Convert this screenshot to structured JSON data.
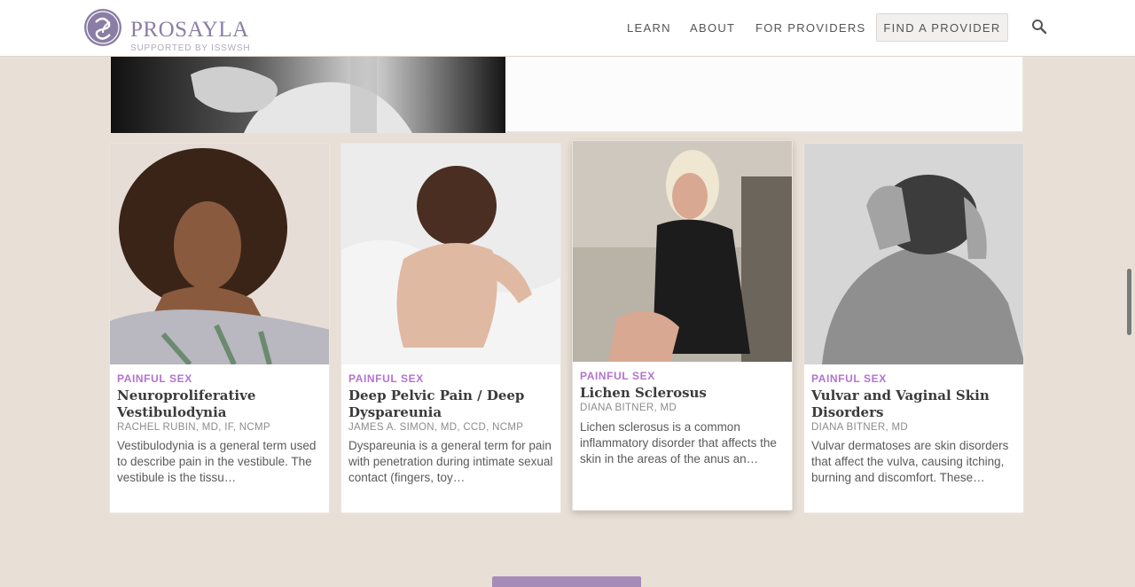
{
  "brand": {
    "name": "PROSAYLA",
    "tagline": "SUPPORTED BY ISSWSH",
    "color": "#8b7ea4"
  },
  "nav": {
    "links": [
      "LEARN",
      "ABOUT",
      "FOR PROVIDERS"
    ],
    "cta": "FIND A PROVIDER",
    "search_icon": "search-icon"
  },
  "accent": "#b572cf",
  "articles": [
    {
      "tag": "PAINFUL SEX",
      "title": "Neuroproliferative Vestibulodynia",
      "author": "RACHEL RUBIN, MD, IF, NCMP",
      "excerpt": "Vestibulodynia is a general term used to describe pain in the vestibule. The vestibule is the tissu…"
    },
    {
      "tag": "PAINFUL SEX",
      "title": "Deep Pelvic Pain / Deep Dyspareunia",
      "author": "JAMES A. SIMON, MD, CCD, NCMP",
      "excerpt": "Dyspareunia is a general term for pain with penetration during intimate sexual contact (fingers, toy…"
    },
    {
      "tag": "PAINFUL SEX",
      "title": "Lichen Sclerosus",
      "author": "DIANA BITNER, MD",
      "excerpt": "Lichen sclerosus is a common inflammatory disorder that affects the skin in the areas of the anus an…"
    },
    {
      "tag": "PAINFUL SEX",
      "title": "Vulvar and Vaginal Skin Disorders",
      "author": "DIANA BITNER, MD",
      "excerpt": "Vulvar dermatoses are skin disorders that affect the vulva, causing itching, burning and discomfort. These…"
    }
  ]
}
